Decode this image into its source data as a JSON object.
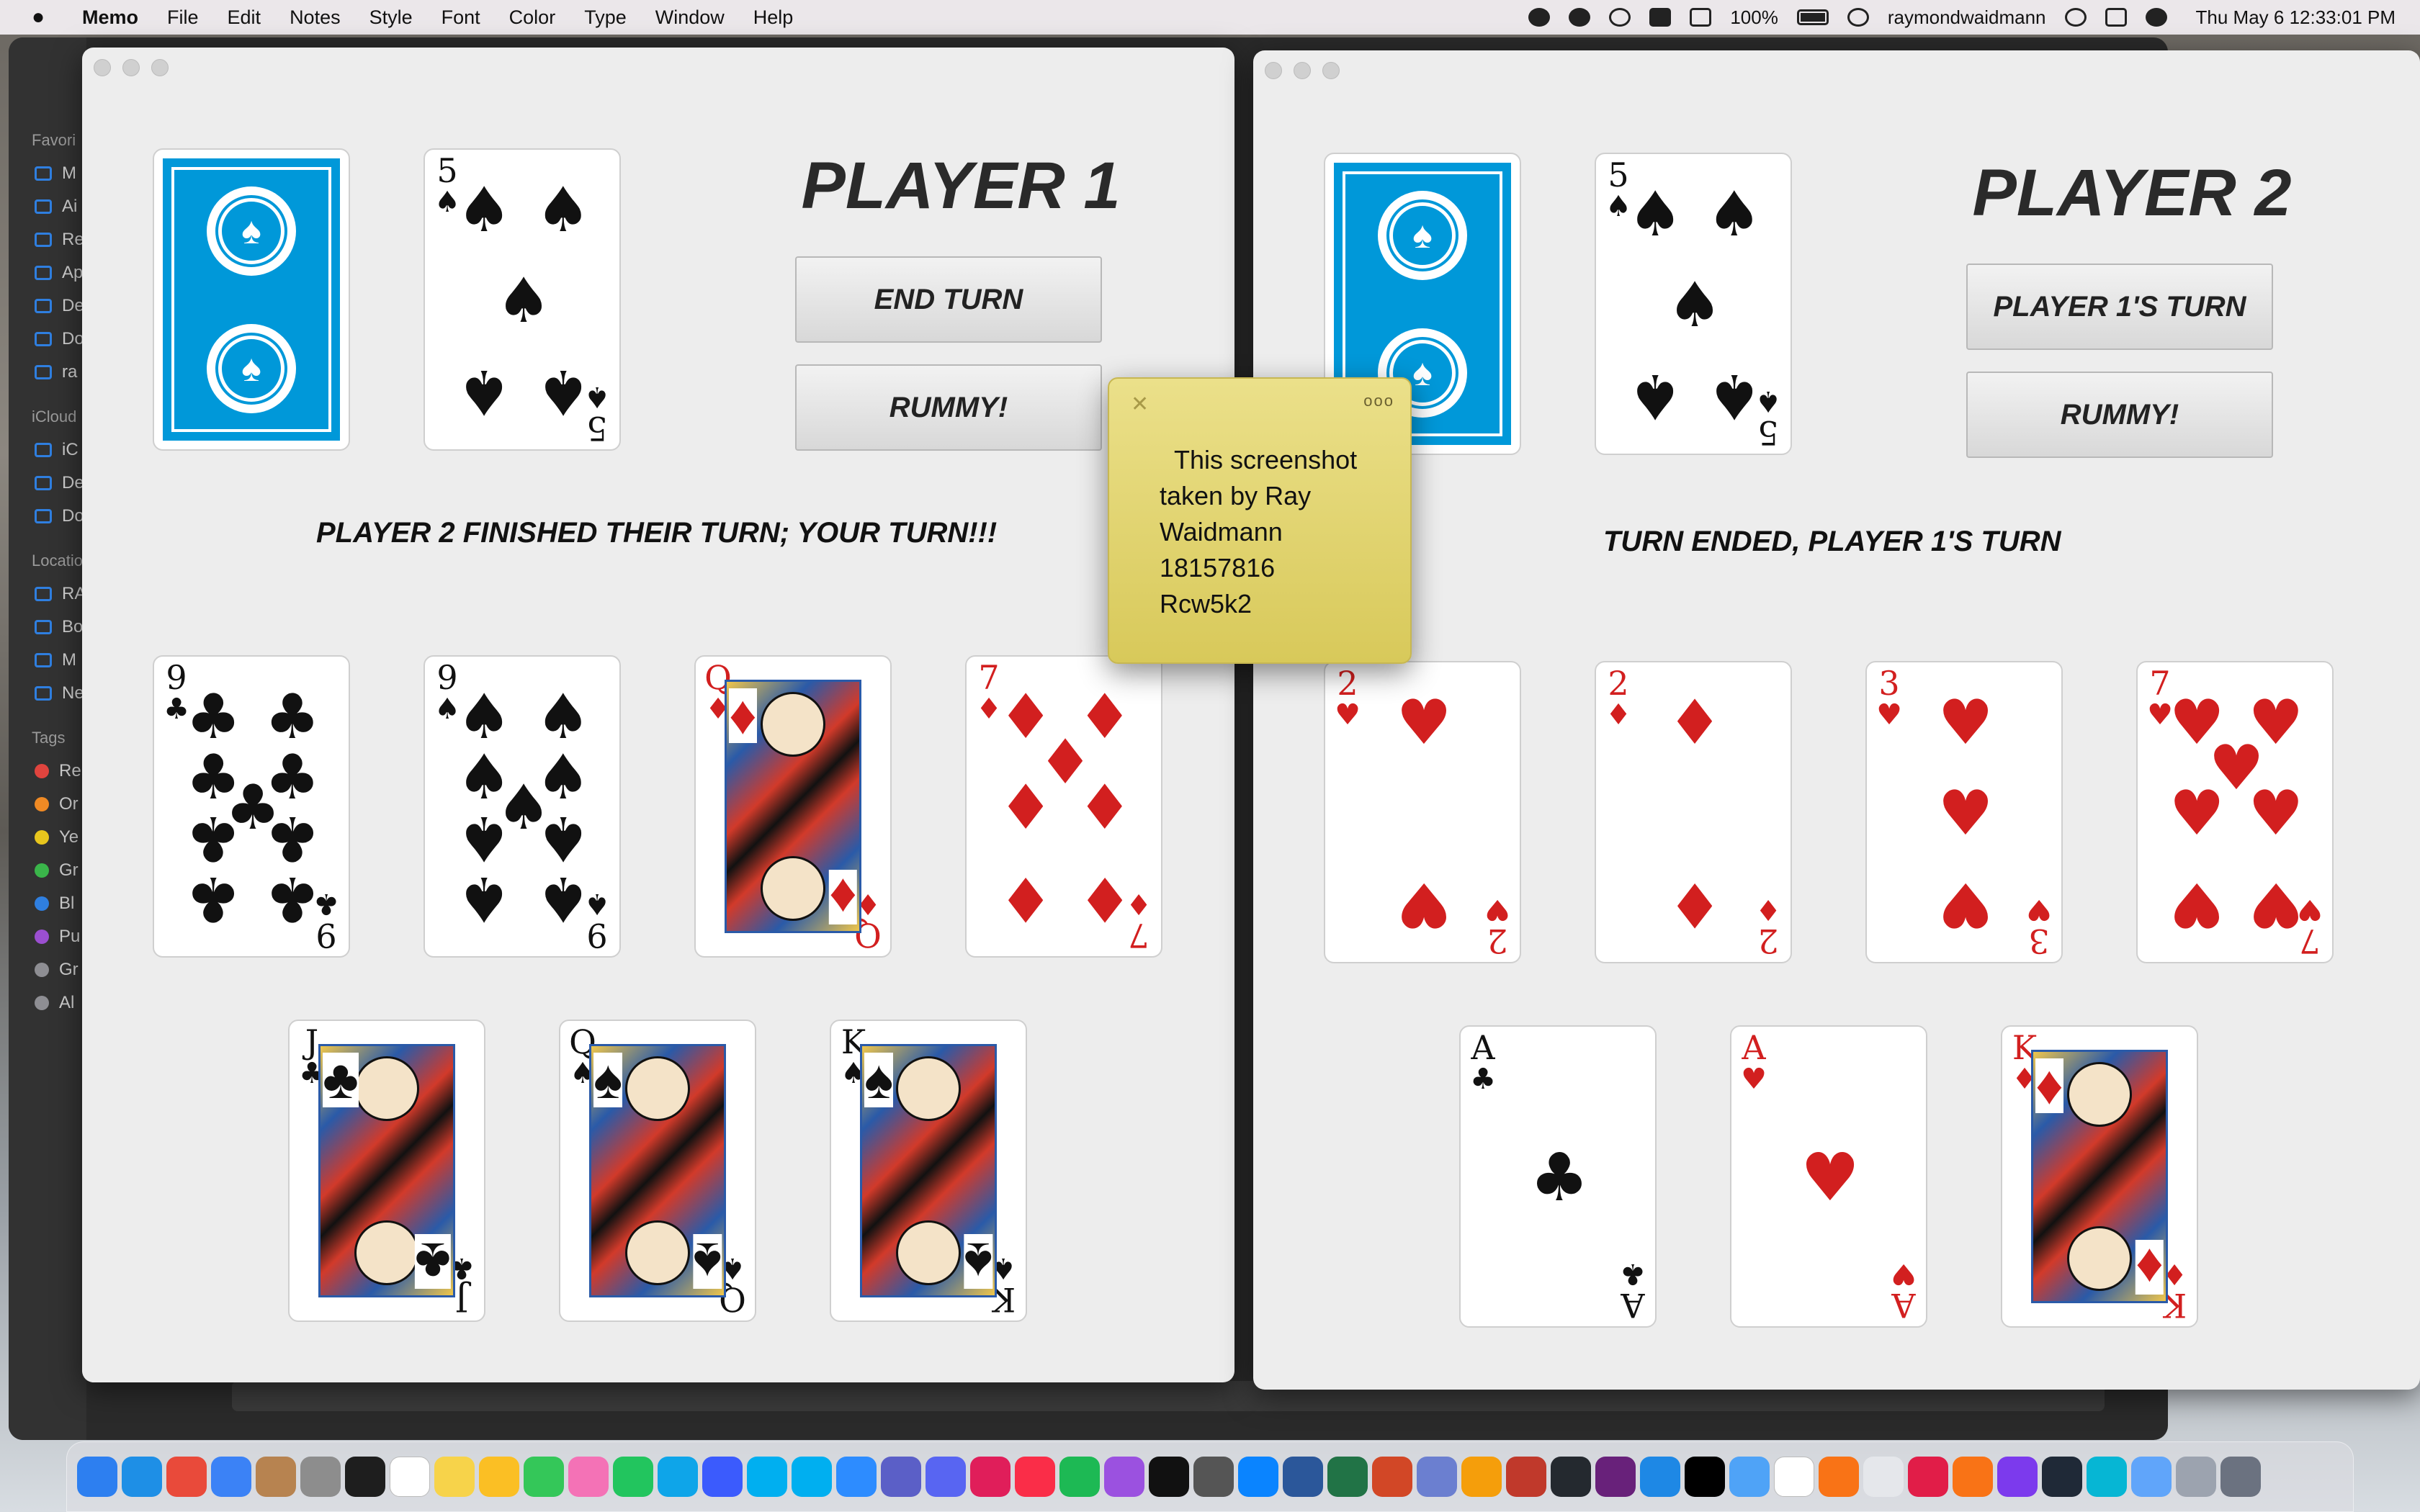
{
  "menubar": {
    "app": "Memo",
    "items": [
      "File",
      "Edit",
      "Notes",
      "Style",
      "Font",
      "Color",
      "Type",
      "Window",
      "Help"
    ],
    "battery": "100%",
    "user": "raymondwaidmann",
    "clock": "Thu May 6  12:33:01 PM"
  },
  "finder_sidebar": {
    "favorites_header": "Favori",
    "favorites": [
      "M",
      "Ai",
      "Re",
      "Ap",
      "De",
      "Do",
      "ra"
    ],
    "icloud_header": "iCloud",
    "icloud": [
      "iC",
      "De",
      "Do"
    ],
    "locations_header": "Locatio",
    "locations": [
      "RA",
      "Bo",
      "M",
      "Ne"
    ],
    "tags_header": "Tags",
    "tags": [
      {
        "label": "Re",
        "color": "#e0443e"
      },
      {
        "label": "Or",
        "color": "#f08a24"
      },
      {
        "label": "Ye",
        "color": "#e8c61d"
      },
      {
        "label": "Gr",
        "color": "#3ab54a"
      },
      {
        "label": "Bl",
        "color": "#2f7fe0"
      },
      {
        "label": "Pu",
        "color": "#9b4fd0"
      },
      {
        "label": "Gr",
        "color": "#8e8e93"
      },
      {
        "label": "Al",
        "color": "#8e8e93"
      }
    ]
  },
  "player1": {
    "title": "PLAYER 1",
    "end_turn": "END TURN",
    "rummy": "RUMMY!",
    "status": "PLAYER 2 FINISHED THEIR TURN; YOUR TURN!!!",
    "discard": {
      "rank": "5",
      "suit": "♠"
    },
    "hand_row1": [
      {
        "rank": "9",
        "suit": "♣"
      },
      {
        "rank": "9",
        "suit": "♠"
      },
      {
        "rank": "Q",
        "suit": "♦"
      },
      {
        "rank": "7",
        "suit": "♦"
      }
    ],
    "hand_row2": [
      {
        "rank": "J",
        "suit": "♣"
      },
      {
        "rank": "Q",
        "suit": "♠"
      },
      {
        "rank": "K",
        "suit": "♠"
      }
    ]
  },
  "player2": {
    "title": "PLAYER 2",
    "turn_button": "PLAYER 1'S TURN",
    "rummy": "RUMMY!",
    "status": "TURN ENDED, PLAYER 1'S TURN",
    "discard": {
      "rank": "5",
      "suit": "♠"
    },
    "hand_row1": [
      {
        "rank": "2",
        "suit": "♥"
      },
      {
        "rank": "2",
        "suit": "♦"
      },
      {
        "rank": "3",
        "suit": "♥"
      },
      {
        "rank": "7",
        "suit": "♥"
      }
    ],
    "hand_row2": [
      {
        "rank": "A",
        "suit": "♣"
      },
      {
        "rank": "A",
        "suit": "♥"
      },
      {
        "rank": "K",
        "suit": "♦"
      }
    ]
  },
  "sticky_note": {
    "close": "✕",
    "more": "ooo",
    "lines": [
      "This screenshot",
      "taken by Ray",
      "Waidmann",
      "18157816",
      "Rcw5k2"
    ]
  },
  "dock": {
    "colors": [
      "#2d7ff0",
      "#1e8fe6",
      "#e94a3a",
      "#3b82f6",
      "#b78350",
      "#8d8d8d",
      "#1e1e1e",
      "#ffffff",
      "#f7d34a",
      "#fbbf24",
      "#34c759",
      "#f472b6",
      "#22c55e",
      "#0ea5e9",
      "#3b5bfd",
      "#00aff0",
      "#00aff0",
      "#2d8cff",
      "#5b5fc7",
      "#5865f2",
      "#e01e5a",
      "#fa2d48",
      "#1db954",
      "#9b51e0",
      "#111111",
      "#555555",
      "#0a84ff",
      "#2b579a",
      "#217346",
      "#d24726",
      "#6b7fd0",
      "#f59e0b",
      "#c0392b",
      "#24292f",
      "#68217a",
      "#1e88e5",
      "#000000",
      "#4fa3f7",
      "#ffffff",
      "#f97316",
      "#e5e7eb",
      "#e11d48",
      "#f97316",
      "#7c3aed",
      "#1f2937",
      "#06b6d4",
      "#60a5fa",
      "#9ca3af",
      "#6b7280"
    ]
  }
}
